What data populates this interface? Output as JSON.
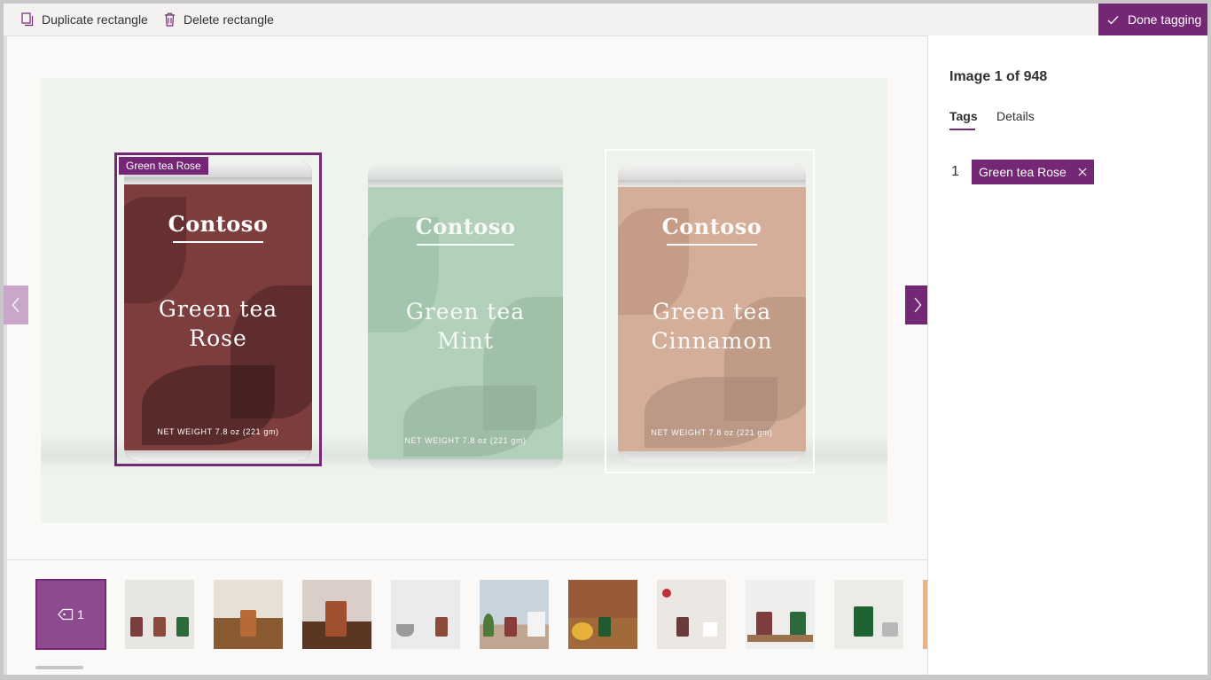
{
  "toolbar": {
    "duplicate_label": "Duplicate rectangle",
    "delete_label": "Delete rectangle",
    "done_label": "Done tagging"
  },
  "colors": {
    "accent": "#742774",
    "canvas_bg": "#eef3ee",
    "panel_bg": "#ffffff"
  },
  "image": {
    "cans": [
      {
        "brand": "Contoso",
        "flavor_line1": "Green tea",
        "flavor_line2": "Rose",
        "weight": "NET WEIGHT 7.8 oz (221 gm)"
      },
      {
        "brand": "Contoso",
        "flavor_line1": "Green tea",
        "flavor_line2": "Mint",
        "weight": "NET WEIGHT 7.8 oz (221 gm)"
      },
      {
        "brand": "Contoso",
        "flavor_line1": "Green tea",
        "flavor_line2": "Cinnamon",
        "weight": "NET WEIGHT 7.8 oz (221 gm)"
      }
    ],
    "selected_region_label": "Green tea Rose"
  },
  "thumbnails": {
    "selected_count": "1"
  },
  "panel": {
    "image_counter": "Image 1 of 948",
    "tabs": [
      {
        "label": "Tags",
        "active": true
      },
      {
        "label": "Details",
        "active": false
      }
    ],
    "tags": [
      {
        "index": "1",
        "label": "Green tea Rose"
      }
    ]
  }
}
